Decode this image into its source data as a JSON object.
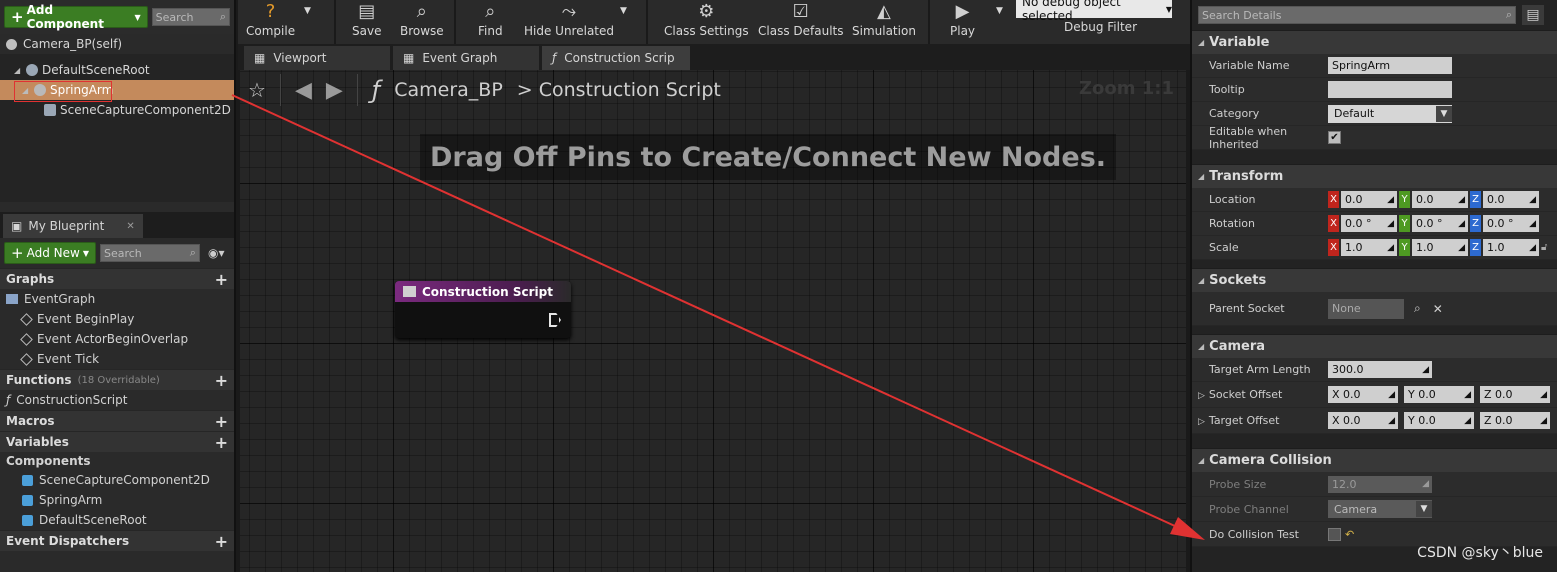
{
  "components_panel": {
    "add_component_label": "Add Component",
    "search_placeholder": "Search",
    "self_label": "Camera_BP(self)",
    "tree": [
      "DefaultSceneRoot",
      "SpringArm",
      "SceneCaptureComponent2D"
    ]
  },
  "my_blueprint": {
    "tab_label": "My Blueprint",
    "add_new_label": "Add New",
    "search_placeholder": "Search",
    "graphs_label": "Graphs",
    "event_graph_label": "EventGraph",
    "events": [
      "Event BeginPlay",
      "Event ActorBeginOverlap",
      "Event Tick"
    ],
    "functions_label": "Functions",
    "functions_count": "(18 Overridable)",
    "construction_script_label": "ConstructionScript",
    "macros_label": "Macros",
    "variables_label": "Variables",
    "components_label": "Components",
    "component_vars": [
      "SceneCaptureComponent2D",
      "SpringArm",
      "DefaultSceneRoot"
    ],
    "event_dispatchers_label": "Event Dispatchers"
  },
  "toolbar": {
    "compile": "Compile",
    "save": "Save",
    "browse": "Browse",
    "find": "Find",
    "hide_unrelated": "Hide Unrelated",
    "class_settings": "Class Settings",
    "class_defaults": "Class Defaults",
    "simulation": "Simulation",
    "play": "Play",
    "debug_object": "No debug object selected",
    "debug_filter": "Debug Filter"
  },
  "tabs": {
    "viewport": "Viewport",
    "event_graph": "Event Graph",
    "construction_script": "Construction Scrip"
  },
  "graph": {
    "breadcrumb_root": "Camera_BP",
    "breadcrumb_sep": ">",
    "breadcrumb_leaf": "Construction Script",
    "zoom": "Zoom 1:1",
    "hint": "Drag Off Pins to Create/Connect New Nodes.",
    "node_title": "Construction Script"
  },
  "details": {
    "search_placeholder": "Search Details",
    "variable_cat": "Variable",
    "variable_name_label": "Variable Name",
    "variable_name": "SpringArm",
    "tooltip_label": "Tooltip",
    "category_label": "Category",
    "category_value": "Default",
    "editable_label": "Editable when Inherited",
    "transform_cat": "Transform",
    "location_label": "Location",
    "location": [
      "0.0",
      "0.0",
      "0.0"
    ],
    "rotation_label": "Rotation",
    "rotation": [
      "0.0 °",
      "0.0 °",
      "0.0 °"
    ],
    "scale_label": "Scale",
    "scale": [
      "1.0",
      "1.0",
      "1.0"
    ],
    "sockets_cat": "Sockets",
    "parent_socket_label": "Parent Socket",
    "parent_socket_value": "None",
    "camera_cat": "Camera",
    "target_arm_length_label": "Target Arm Length",
    "target_arm_length": "300.0",
    "socket_offset_label": "Socket Offset",
    "socket_offset": [
      "0.0",
      "0.0",
      "0.0"
    ],
    "target_offset_label": "Target Offset",
    "target_offset": [
      "0.0",
      "0.0",
      "0.0"
    ],
    "camera_collision_cat": "Camera Collision",
    "probe_size_label": "Probe Size",
    "probe_size": "12.0",
    "probe_channel_label": "Probe Channel",
    "probe_channel": "Camera",
    "do_collision_label": "Do Collision Test"
  },
  "axes": {
    "x": "X",
    "y": "Y",
    "z": "Z"
  },
  "watermark": "CSDN @sky丶blue",
  "colors": {
    "selection": "#c48a5c",
    "annotation_red": "#e03232",
    "add_green": "#3b7d23"
  }
}
